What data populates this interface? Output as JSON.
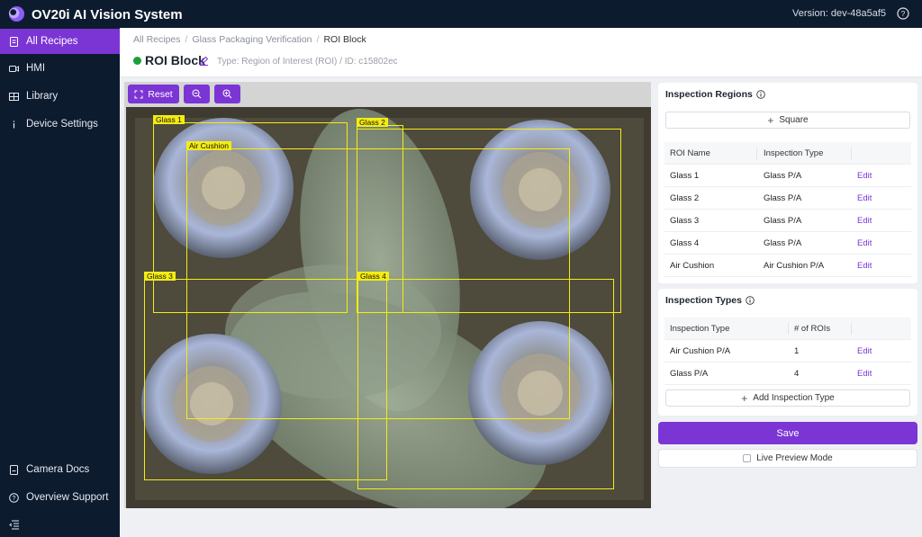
{
  "app": {
    "title": "OV20i AI Vision System",
    "version": "Version: dev-48a5af5"
  },
  "sidebar": {
    "items": [
      {
        "label": "All Recipes",
        "icon": "document-icon",
        "active": true
      },
      {
        "label": "HMI",
        "icon": "video-icon",
        "active": false
      },
      {
        "label": "Library",
        "icon": "grid-icon",
        "active": false
      },
      {
        "label": "Device Settings",
        "icon": "info-icon",
        "active": false
      }
    ],
    "bottom_items": [
      {
        "label": "Camera Docs",
        "icon": "document-icon"
      },
      {
        "label": "Overview Support",
        "icon": "help-icon"
      }
    ]
  },
  "breadcrumb": [
    "All Recipes",
    "Glass Packaging Verification",
    "ROI Block"
  ],
  "page": {
    "title": "ROI Block",
    "meta": "Type: Region of Interest (ROI) / ID: c15802ec",
    "status_color": "#1e9e3a"
  },
  "toolbar": {
    "reset_label": "Reset",
    "zoom_out_icon": "zoom-out-icon",
    "zoom_in_icon": "zoom-in-icon"
  },
  "rois": [
    {
      "label": "Glass 1"
    },
    {
      "label": "Glass 2"
    },
    {
      "label": "Air Cushion"
    },
    {
      "label": "Glass 3"
    },
    {
      "label": "Glass 4"
    }
  ],
  "inspection_regions": {
    "title": "Inspection Regions",
    "add_label": "Square",
    "headers": [
      "ROI Name",
      "Inspection Type",
      ""
    ],
    "rows": [
      {
        "name": "Glass 1",
        "type": "Glass P/A",
        "action": "Edit"
      },
      {
        "name": "Glass 2",
        "type": "Glass P/A",
        "action": "Edit"
      },
      {
        "name": "Glass 3",
        "type": "Glass P/A",
        "action": "Edit"
      },
      {
        "name": "Glass 4",
        "type": "Glass P/A",
        "action": "Edit"
      },
      {
        "name": "Air Cushion",
        "type": "Air Cushion P/A",
        "action": "Edit"
      }
    ]
  },
  "inspection_types": {
    "title": "Inspection Types",
    "headers": [
      "Inspection Type",
      "# of ROIs",
      ""
    ],
    "rows": [
      {
        "type": "Air Cushion P/A",
        "count": "1",
        "action": "Edit"
      },
      {
        "type": "Glass P/A",
        "count": "4",
        "action": "Edit"
      }
    ],
    "add_label": "Add Inspection Type"
  },
  "save_label": "Save",
  "live_preview_label": "Live Preview Mode",
  "colors": {
    "accent": "#7b35d4",
    "nav_bg": "#0d1b2f",
    "roi": "#f5ec13"
  }
}
